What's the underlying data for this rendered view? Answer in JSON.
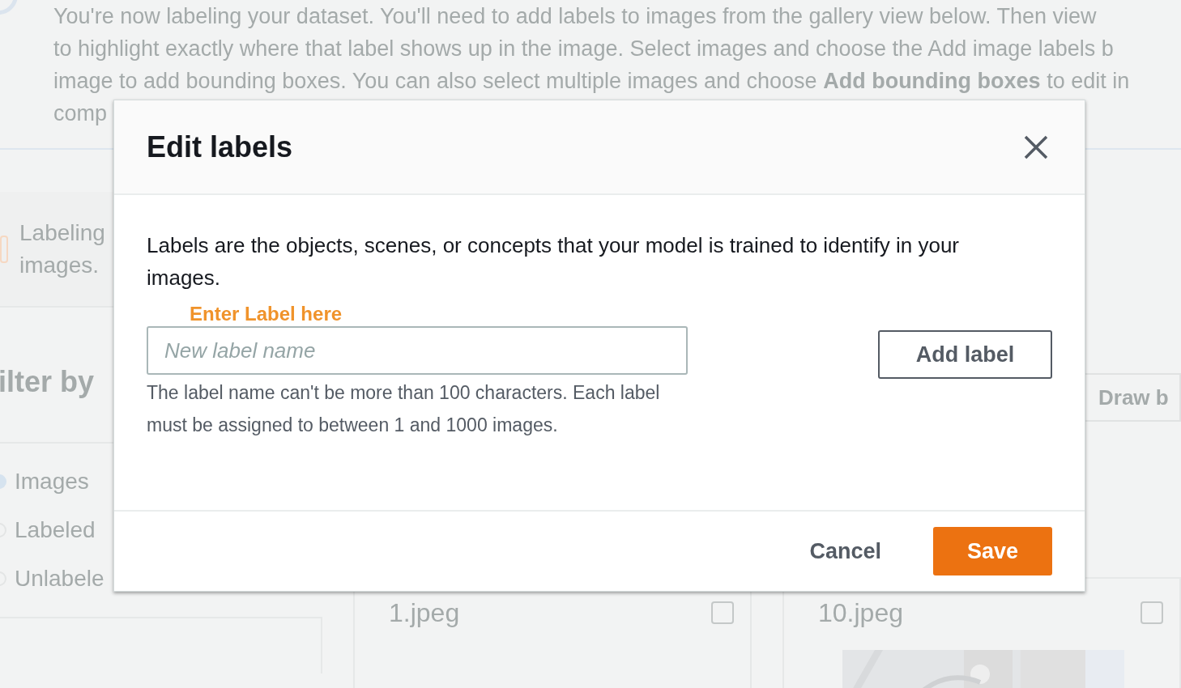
{
  "intro": {
    "lines": [
      "You're now labeling your dataset. You'll need to add labels to images from the gallery view below. Then view",
      "to highlight exactly where that label shows up in the image. Select images and choose the Add image labels b",
      "image to add bounding boxes. You can also select multiple images and choose **Add bounding boxes** to edit in",
      "comp"
    ]
  },
  "notice": {
    "lines": [
      "Labeling",
      "images."
    ]
  },
  "filter": {
    "title": "ilter by",
    "options": [
      {
        "label": "Images",
        "selected": true
      },
      {
        "label": "Labeled",
        "selected": false
      },
      {
        "label": "Unlabele",
        "selected": false
      }
    ]
  },
  "draw_button": "Draw b",
  "gallery": [
    {
      "name": "1.jpeg",
      "checked": false
    },
    {
      "name": "10.jpeg",
      "checked": false,
      "kind": "picture"
    }
  ],
  "dialog": {
    "title": "Edit labels",
    "description": "Labels are the objects, scenes, or concepts that your model is trained to identify in your images.",
    "field": {
      "label": "Enter Label here",
      "placeholder": "New label name"
    },
    "hint": "The label name can't be more than 100 characters. Each label must be assigned to between 1 and 1000 images.",
    "add_button": "Add label",
    "buttons": [
      {
        "label": "Cancel",
        "kind": "link"
      },
      {
        "label": "Save",
        "kind": "primary"
      }
    ]
  }
}
